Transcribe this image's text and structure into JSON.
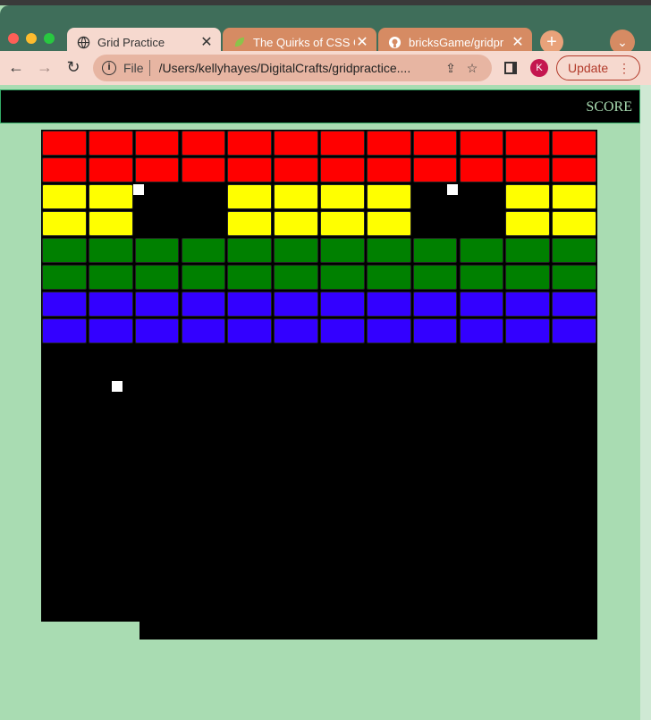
{
  "browser": {
    "tabs": [
      {
        "title": "Grid Practice",
        "active": true,
        "icon": "globe-icon"
      },
      {
        "title": "The Quirks of CSS G",
        "active": false,
        "icon": "leaf-icon"
      },
      {
        "title": "bricksGame/gridpr",
        "active": false,
        "icon": "github-icon"
      }
    ],
    "new_tab_icon": "plus-icon",
    "address": {
      "scheme": "File",
      "url": "/Users/kellyhayes/DigitalCrafts/gridpractice...."
    },
    "profile_initial": "K",
    "update_label": "Update",
    "accent_color": "#d68b63"
  },
  "game": {
    "score_label": "SCORE",
    "background_color": "#a9dcb2",
    "board_color": "#000000",
    "brick_grid": {
      "columns": 12,
      "rows": [
        {
          "color": "#ff0000",
          "missing": []
        },
        {
          "color": "#ff0000",
          "missing": []
        },
        {
          "color": "#ffff00",
          "missing": [
            2,
            3,
            8,
            9
          ]
        },
        {
          "color": "#ffff00",
          "missing": [
            2,
            3,
            8,
            9
          ]
        },
        {
          "color": "#008000",
          "missing": []
        },
        {
          "color": "#008000",
          "missing": []
        },
        {
          "color": "#3300ff",
          "missing": []
        },
        {
          "color": "#3300ff",
          "missing": []
        }
      ]
    },
    "balls_count": 3
  }
}
